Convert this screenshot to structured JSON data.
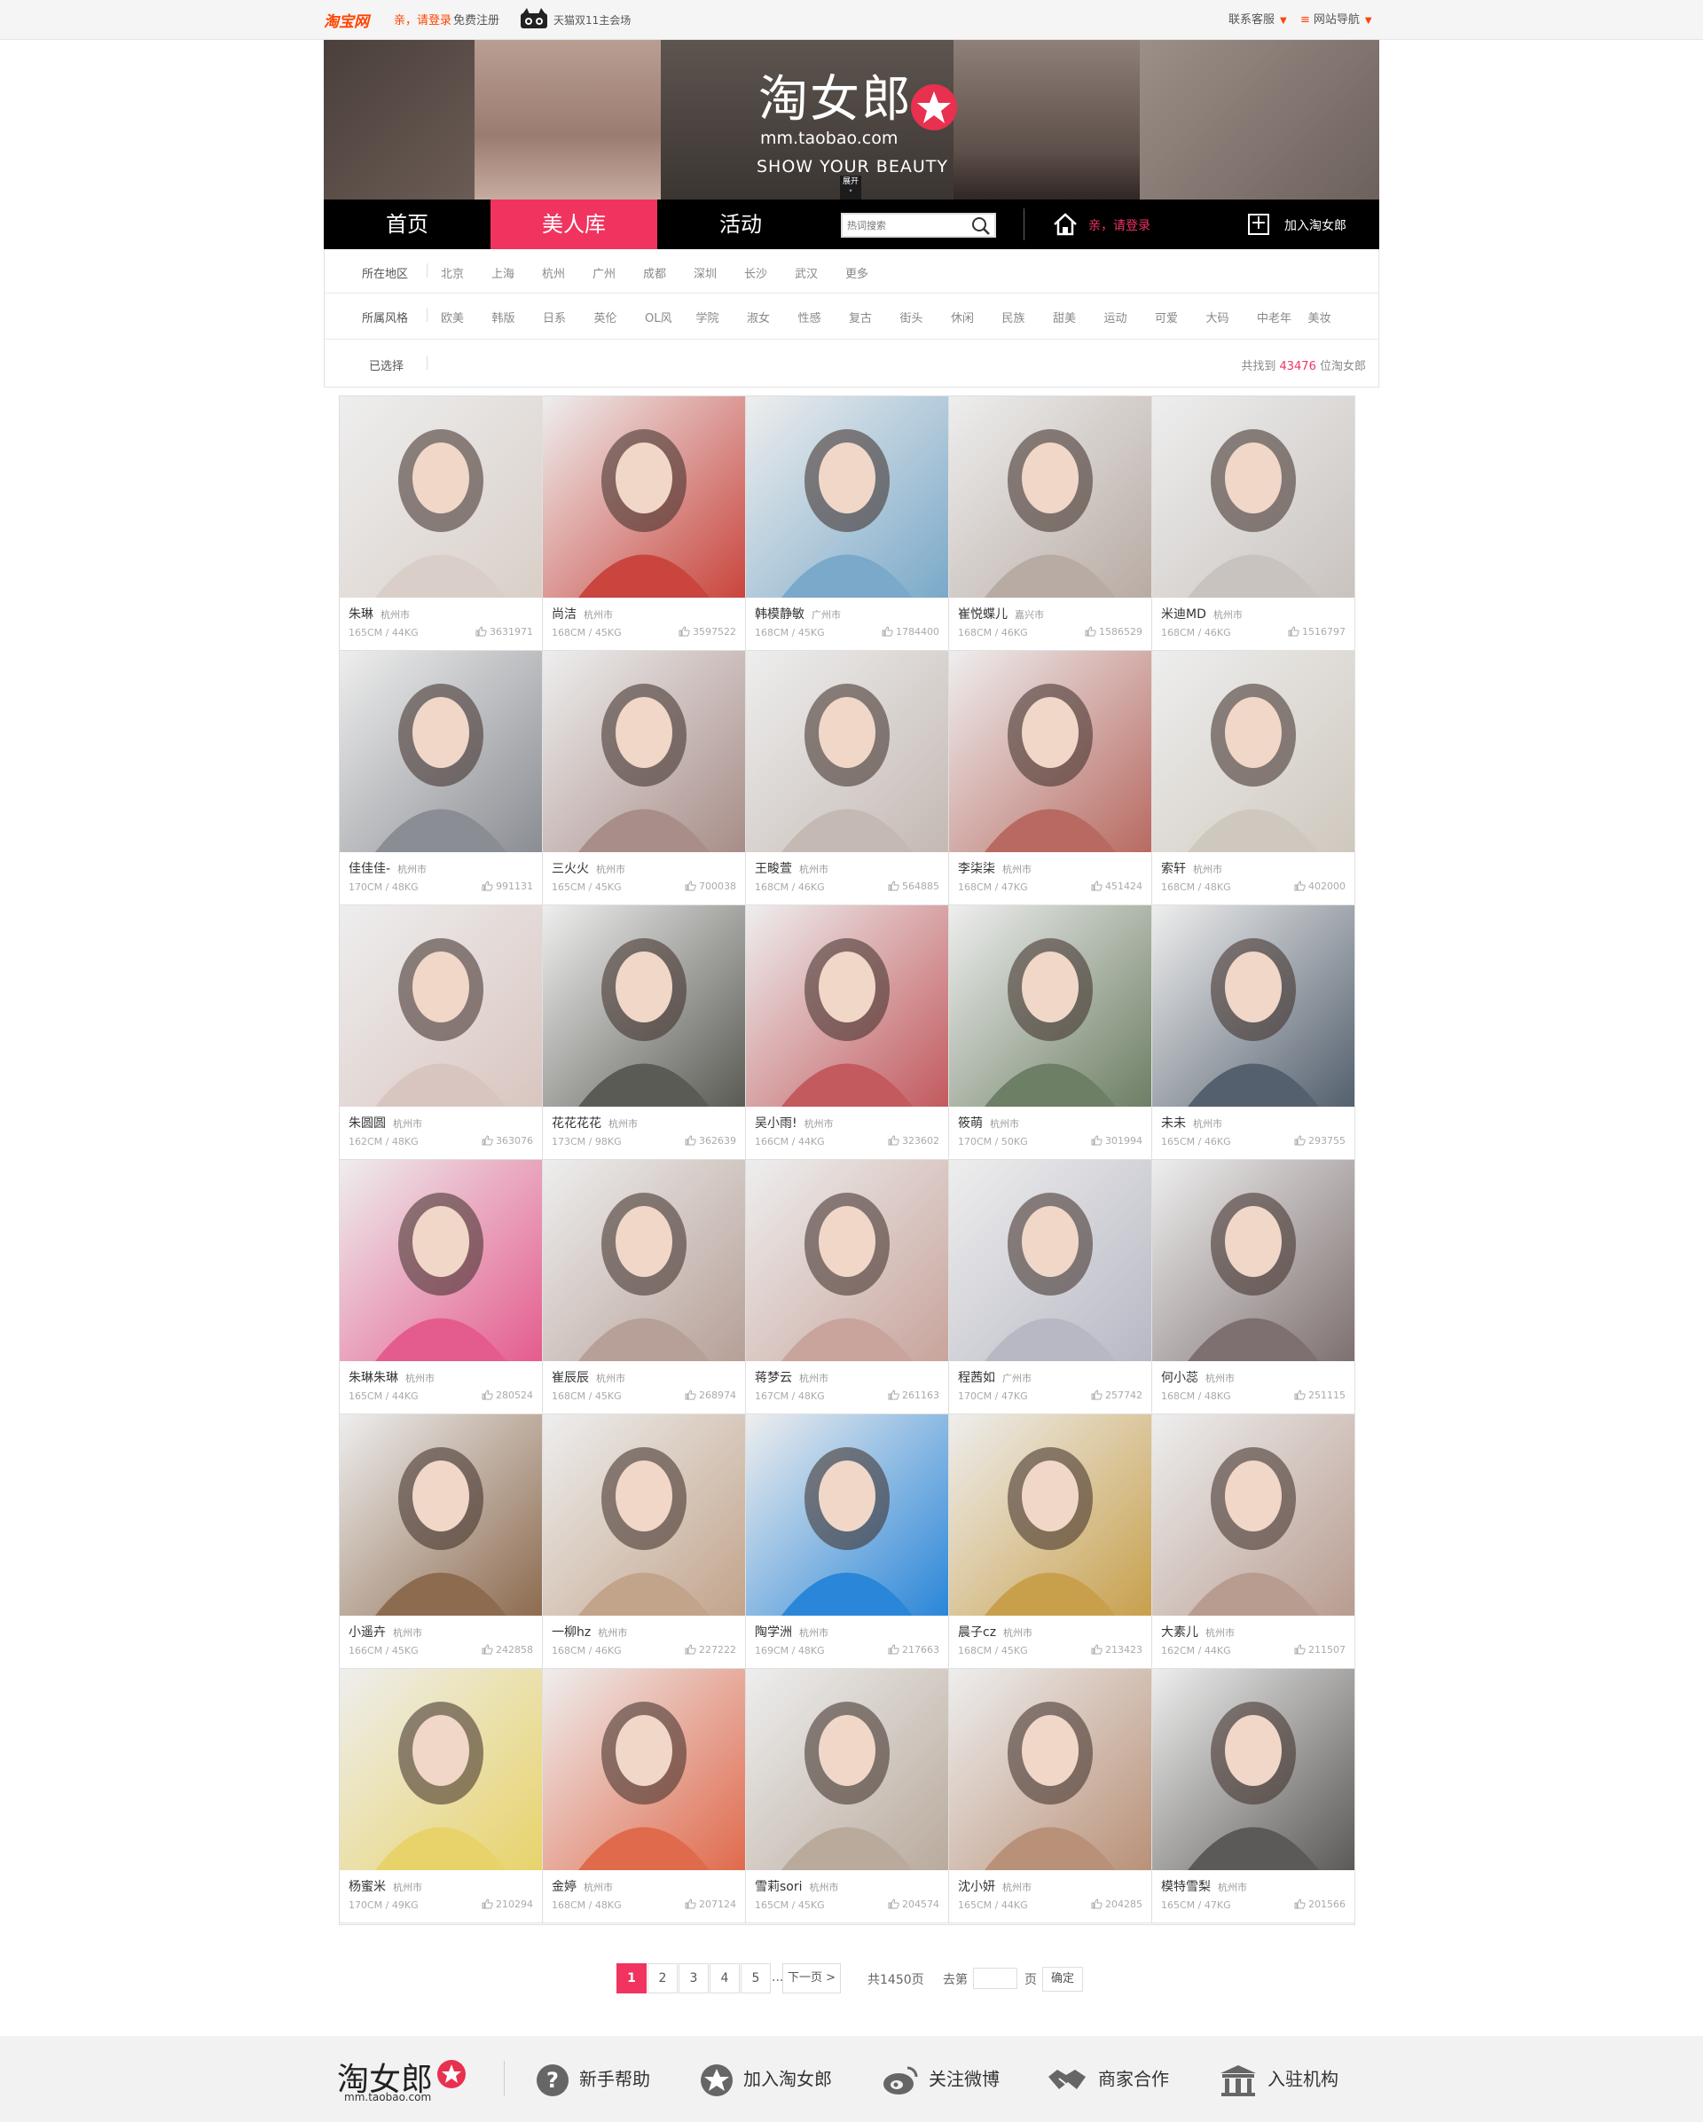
{
  "topbar": {
    "logo": "淘宝网",
    "login": "亲，请登录",
    "register": "免费注册",
    "tmall": "天猫双11主会场",
    "service": "联系客服",
    "site_nav": "网站导航"
  },
  "banner": {
    "logo": "淘女郎",
    "url": "mm.taobao.com",
    "slogan": "SHOW YOUR BEAUTY",
    "expand": "展开"
  },
  "nav": {
    "items": [
      "首页",
      "美人库",
      "活动"
    ],
    "search_placeholder": "热词搜索",
    "login": "亲，请登录",
    "join": "加入淘女郎"
  },
  "filters": {
    "region_label": "所在地区",
    "regions": [
      "北京",
      "上海",
      "杭州",
      "广州",
      "成都",
      "深圳",
      "长沙",
      "武汉",
      "更多"
    ],
    "style_label": "所属风格",
    "styles": [
      "欧美",
      "韩版",
      "日系",
      "英伦",
      "OL风",
      "学院",
      "淑女",
      "性感",
      "复古",
      "街头",
      "休闲",
      "民族",
      "甜美",
      "运动",
      "可爱",
      "大码",
      "中老年",
      "美妆"
    ],
    "selected_label": "已选择",
    "count_prefix": "共找到",
    "count": "43476",
    "count_suffix": "位淘女郎"
  },
  "models": [
    {
      "name": "朱琳",
      "city": "杭州市",
      "stats": "165CM / 44KG",
      "likes": "3631971",
      "color": "#d9cfc8"
    },
    {
      "name": "尚洁",
      "city": "杭州市",
      "stats": "168CM / 45KG",
      "likes": "3597522",
      "color": "#c9453d"
    },
    {
      "name": "韩模静敏",
      "city": "广州市",
      "stats": "168CM / 45KG",
      "likes": "1784400",
      "color": "#7aa9c9"
    },
    {
      "name": "崔悦蝶儿",
      "city": "嘉兴市",
      "stats": "168CM / 46KG",
      "likes": "1586529",
      "color": "#b8aba3"
    },
    {
      "name": "米迪MD",
      "city": "杭州市",
      "stats": "168CM / 46KG",
      "likes": "1516797",
      "color": "#c9c3bf"
    },
    {
      "name": "佳佳佳-",
      "city": "杭州市",
      "stats": "170CM / 48KG",
      "likes": "991131",
      "color": "#8a8d93"
    },
    {
      "name": "三火火",
      "city": "杭州市",
      "stats": "165CM / 45KG",
      "likes": "700038",
      "color": "#a88d88"
    },
    {
      "name": "王畯萱",
      "city": "杭州市",
      "stats": "168CM / 46KG",
      "likes": "564885",
      "color": "#c4b9b3"
    },
    {
      "name": "李柒柒",
      "city": "杭州市",
      "stats": "168CM / 47KG",
      "likes": "451424",
      "color": "#b86a62"
    },
    {
      "name": "索轩",
      "city": "杭州市",
      "stats": "168CM / 48KG",
      "likes": "402000",
      "color": "#cfc8be"
    },
    {
      "name": "朱圆圆",
      "city": "杭州市",
      "stats": "162CM / 48KG",
      "likes": "363076",
      "color": "#d9c5c0"
    },
    {
      "name": "花花花花",
      "city": "杭州市",
      "stats": "173CM / 98KG",
      "likes": "362639",
      "color": "#5b5b55"
    },
    {
      "name": "吴小雨!",
      "city": "杭州市",
      "stats": "166CM / 44KG",
      "likes": "323602",
      "color": "#c25a5e"
    },
    {
      "name": "筱萌",
      "city": "杭州市",
      "stats": "170CM / 50KG",
      "likes": "301994",
      "color": "#6d7f64"
    },
    {
      "name": "未未",
      "city": "杭州市",
      "stats": "165CM / 46KG",
      "likes": "293755",
      "color": "#54606e"
    },
    {
      "name": "朱琳朱琳",
      "city": "杭州市",
      "stats": "165CM / 44KG",
      "likes": "280524",
      "color": "#e45c8e"
    },
    {
      "name": "崔辰辰",
      "city": "杭州市",
      "stats": "168CM / 45KG",
      "likes": "268974",
      "color": "#b6a097"
    },
    {
      "name": "蒋梦云",
      "city": "杭州市",
      "stats": "167CM / 48KG",
      "likes": "261163",
      "color": "#c8a49c"
    },
    {
      "name": "程茜如",
      "city": "广州市",
      "stats": "170CM / 47KG",
      "likes": "257742",
      "color": "#b7b8c4"
    },
    {
      "name": "何小蕊",
      "city": "杭州市",
      "stats": "168CM / 48KG",
      "likes": "251115",
      "color": "#7e7070"
    },
    {
      "name": "小遥卉",
      "city": "杭州市",
      "stats": "166CM / 45KG",
      "likes": "242858",
      "color": "#8d6b4f"
    },
    {
      "name": "一柳hz",
      "city": "杭州市",
      "stats": "168CM / 46KG",
      "likes": "227222",
      "color": "#c2a48b"
    },
    {
      "name": "陶学洲",
      "city": "杭州市",
      "stats": "169CM / 48KG",
      "likes": "217663",
      "color": "#2a86d8"
    },
    {
      "name": "晨子cz",
      "city": "杭州市",
      "stats": "168CM / 45KG",
      "likes": "213423",
      "color": "#c8a04c"
    },
    {
      "name": "大素儿",
      "city": "杭州市",
      "stats": "162CM / 44KG",
      "likes": "211507",
      "color": "#b89c90"
    },
    {
      "name": "杨蜜米",
      "city": "杭州市",
      "stats": "170CM / 49KG",
      "likes": "210294",
      "color": "#e8d36a"
    },
    {
      "name": "金婷",
      "city": "杭州市",
      "stats": "168CM / 48KG",
      "likes": "207124",
      "color": "#e06a4c"
    },
    {
      "name": "雪莉sori",
      "city": "杭州市",
      "stats": "165CM / 45KG",
      "likes": "204574",
      "color": "#b9aa9c"
    },
    {
      "name": "沈小妍",
      "city": "杭州市",
      "stats": "165CM / 44KG",
      "likes": "204285",
      "color": "#b99178"
    },
    {
      "name": "模特雪梨",
      "city": "杭州市",
      "stats": "165CM / 47KG",
      "likes": "201566",
      "color": "#5c5a58"
    }
  ],
  "pagination": {
    "pages": [
      "1",
      "2",
      "3",
      "4",
      "5"
    ],
    "ellipsis": "...",
    "next": "下一页 >",
    "total": "共1450页",
    "goto": "去第",
    "page_unit": "页",
    "confirm": "确定"
  },
  "footer": {
    "logo": "淘女郎",
    "url": "mm.taobao.com",
    "items": [
      "新手帮助",
      "加入淘女郎",
      "关注微博",
      "商家合作",
      "入驻机构"
    ]
  }
}
